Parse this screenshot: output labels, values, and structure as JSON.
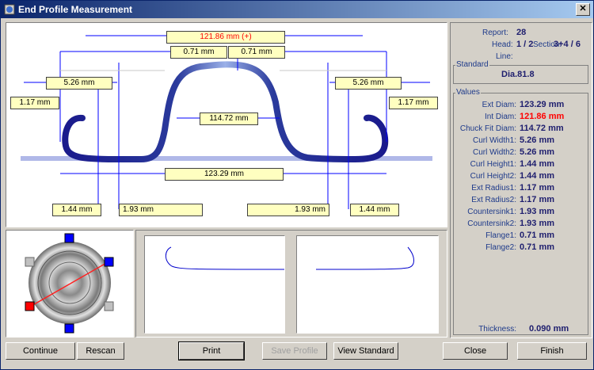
{
  "window": {
    "title": "End Profile Measurement",
    "close_glyph": "✕"
  },
  "dims": {
    "total": "121.86 mm (+)",
    "flange_left": "0.71 mm",
    "flange_right": "0.71 mm",
    "curl_width_left": "5.26 mm",
    "curl_width_right": "5.26 mm",
    "ext_radius_left": "1.17 mm",
    "ext_radius_right": "1.17 mm",
    "chuck": "114.72 mm",
    "ext_diam": "123.29 mm",
    "curl_height_left": "1.44 mm",
    "countersink_left": "1.93 mm",
    "countersink_right": "1.93 mm",
    "curl_height_right": "1.44 mm"
  },
  "info": {
    "report_label": "Report:",
    "report_value": "28",
    "head_label": "Head:",
    "head_value": "1 / 2",
    "section_label": "Section:",
    "section_value": "3+4 / 6",
    "line_label": "Line:"
  },
  "standard": {
    "title": "Standard",
    "value": "Dia.81.8"
  },
  "values": {
    "title": "Values",
    "rows": [
      {
        "label": "Ext Diam:",
        "value": "123.29 mm"
      },
      {
        "label": "Int Diam:",
        "value": "121.86 mm"
      },
      {
        "label": "Chuck Fit Diam:",
        "value": "114.72 mm"
      },
      {
        "label": "Curl Width1:",
        "value": "5.26 mm"
      },
      {
        "label": "Curl Width2:",
        "value": "5.26 mm"
      },
      {
        "label": "Curl Height1:",
        "value": "1.44 mm"
      },
      {
        "label": "Curl Height2:",
        "value": "1.44 mm"
      },
      {
        "label": "Ext Radius1:",
        "value": "1.17 mm"
      },
      {
        "label": "Ext Radius2:",
        "value": "1.17 mm"
      },
      {
        "label": "Countersink1:",
        "value": "1.93 mm"
      },
      {
        "label": "Countersink2:",
        "value": "1.93 mm"
      },
      {
        "label": "Flange1:",
        "value": "0.71 mm"
      },
      {
        "label": "Flange2:",
        "value": "0.71 mm"
      }
    ],
    "thickness_label": "Thickness:",
    "thickness_value": "0.090 mm"
  },
  "buttons": {
    "continue": "Continue",
    "rescan": "Rescan",
    "print": "Print",
    "save_profile": "Save Profile",
    "view_standard": "View Standard",
    "close": "Close",
    "finish": "Finish"
  },
  "colors": {
    "highlight": "#ff0000",
    "profile": "#1a1a8c",
    "dim_line": "#0000ff"
  }
}
